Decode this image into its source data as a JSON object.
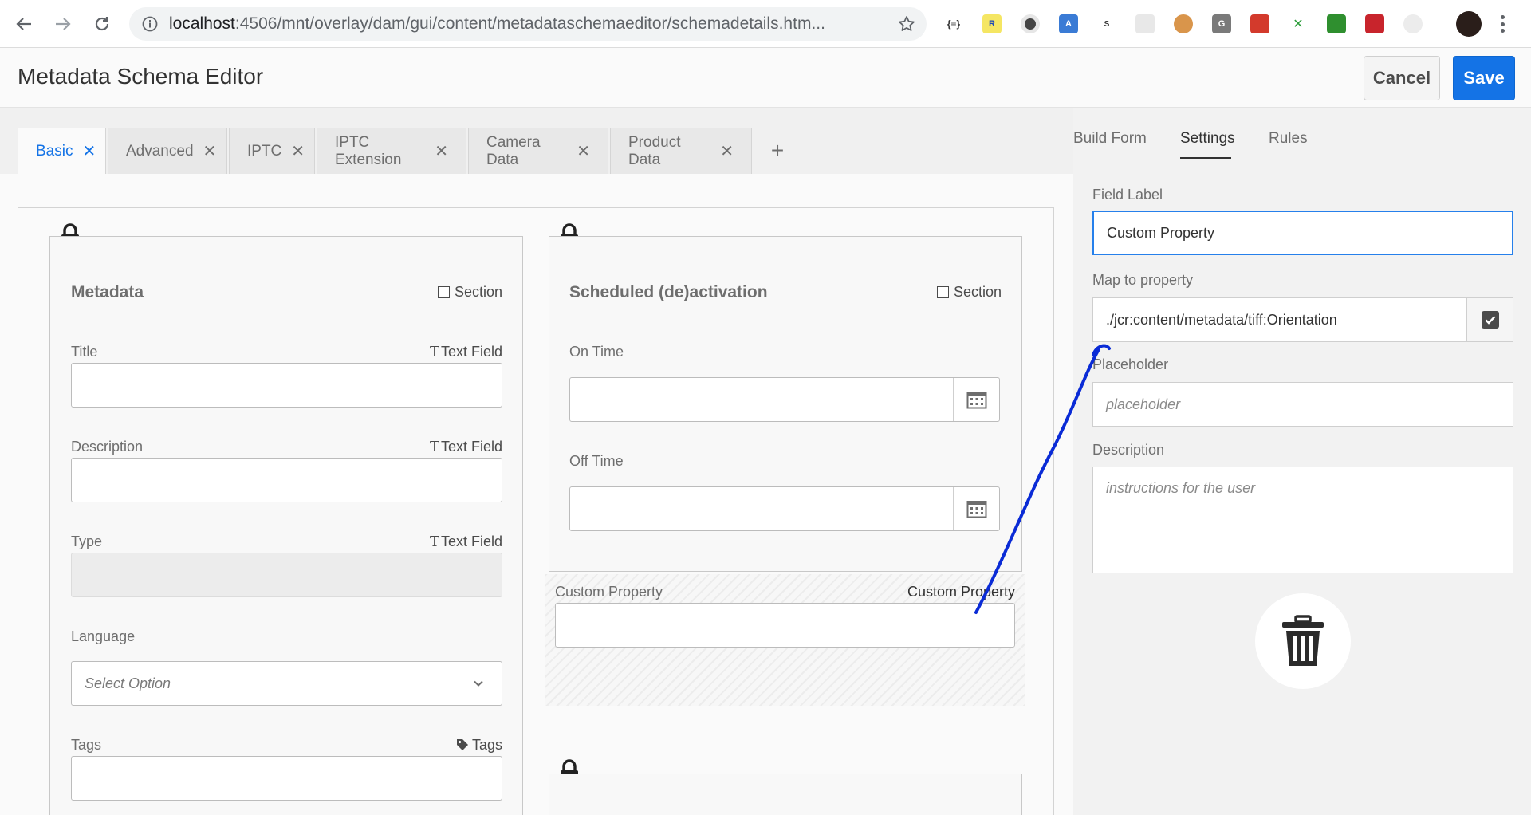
{
  "browser": {
    "url_host": "localhost",
    "url_path": ":4506/mnt/overlay/dam/gui/content/metadataschemaeditor/schemadetails.htm..."
  },
  "header": {
    "title": "Metadata Schema Editor",
    "cancel_label": "Cancel",
    "save_label": "Save"
  },
  "tabs": [
    {
      "label": "Basic"
    },
    {
      "label": "Advanced"
    },
    {
      "label": "IPTC"
    },
    {
      "label": "IPTC Extension"
    },
    {
      "label": "Camera Data"
    },
    {
      "label": "Product Data"
    }
  ],
  "add_tab_symbol": "+",
  "close_symbol": "✕",
  "sections": {
    "metadata": {
      "title": "Metadata",
      "section_label": "Section",
      "fields": [
        {
          "label": "Title",
          "type": "Text Field"
        },
        {
          "label": "Description",
          "type": "Text Field"
        },
        {
          "label": "Type",
          "type": "Text Field"
        },
        {
          "label": "Language",
          "placeholder": "Select Option"
        },
        {
          "label": "Tags",
          "type": "Tags"
        }
      ]
    },
    "scheduled": {
      "title": "Scheduled (de)activation",
      "section_label": "Section",
      "fields": [
        {
          "label": "On Time"
        },
        {
          "label": "Off Time"
        }
      ]
    },
    "custom": {
      "label": "Custom Property",
      "type": "Custom Property"
    }
  },
  "right_panel": {
    "tabs": [
      "Build Form",
      "Settings",
      "Rules"
    ],
    "active_tab": "Settings",
    "field_label_label": "Field Label",
    "field_label_value": "Custom Property",
    "map_label": "Map to property",
    "map_value": "./jcr:content/metadata/tiff:Orientation",
    "placeholder_label": "Placeholder",
    "placeholder_hint": "placeholder",
    "description_label": "Description",
    "description_hint": "instructions for the user"
  },
  "colors": {
    "accent": "#1473e6",
    "annotation_stroke": "#0a2bd6"
  },
  "icons": [
    "back-icon",
    "forward-icon",
    "reload-icon",
    "info-icon",
    "star-icon",
    "lock-icon",
    "calendar-icon",
    "chevron-down-icon",
    "tag-icon",
    "text-field-icon",
    "checkbox-icon",
    "trash-icon"
  ]
}
